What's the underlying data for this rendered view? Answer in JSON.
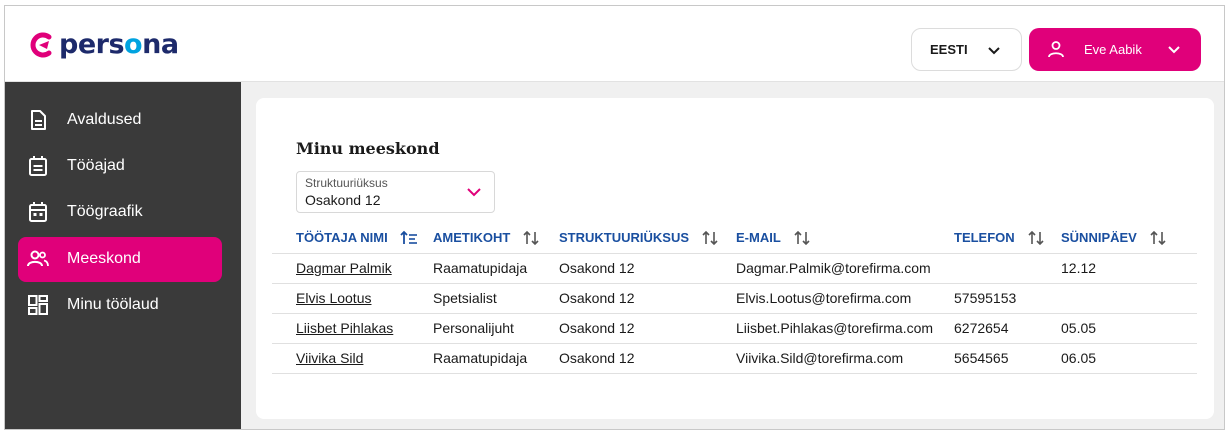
{
  "app": {
    "logo_prefix": "pers",
    "logo_accent": "o",
    "logo_suffix": "na"
  },
  "header": {
    "language": "EESTI",
    "user_name": "Eve Aabik"
  },
  "sidebar": {
    "items": [
      {
        "label": "Avaldused",
        "icon": "document-icon"
      },
      {
        "label": "Tööajad",
        "icon": "calendar-list-icon"
      },
      {
        "label": "Töögraafik",
        "icon": "calendar-icon"
      },
      {
        "label": "Meeskond",
        "icon": "people-icon",
        "active": true
      },
      {
        "label": "Minu töölaud",
        "icon": "dashboard-icon"
      }
    ]
  },
  "main": {
    "title": "Minu meeskond",
    "filter": {
      "label": "Struktuuriüksus",
      "value": "Osakond 12"
    },
    "table": {
      "columns": [
        "TÖÖTAJA NIMI",
        "AMETIKOHT",
        "STRUKTUURIÜKSUS",
        "E-MAIL",
        "TELEFON",
        "SÜNNIPÄEV"
      ],
      "rows": [
        [
          "Dagmar Palmik",
          "Raamatupidaja",
          "Osakond 12",
          "Dagmar.Palmik@torefirma.com",
          "",
          "12.12"
        ],
        [
          "Elvis Lootus",
          "Spetsialist",
          "Osakond 12",
          "Elvis.Lootus@torefirma.com",
          "57595153",
          ""
        ],
        [
          "Liisbet Pihlakas",
          "Personalijuht",
          "Osakond 12",
          "Liisbet.Pihlakas@torefirma.com",
          "6272654",
          "05.05"
        ],
        [
          "Viivika Sild",
          "Raamatupidaja",
          "Osakond 12",
          "Viivika.Sild@torefirma.com",
          "5654565",
          "06.05"
        ]
      ]
    }
  },
  "colors": {
    "brand_pink": "#e0007a",
    "sidebar_bg": "#3a3a3a",
    "header_link": "#1a4fa0"
  }
}
